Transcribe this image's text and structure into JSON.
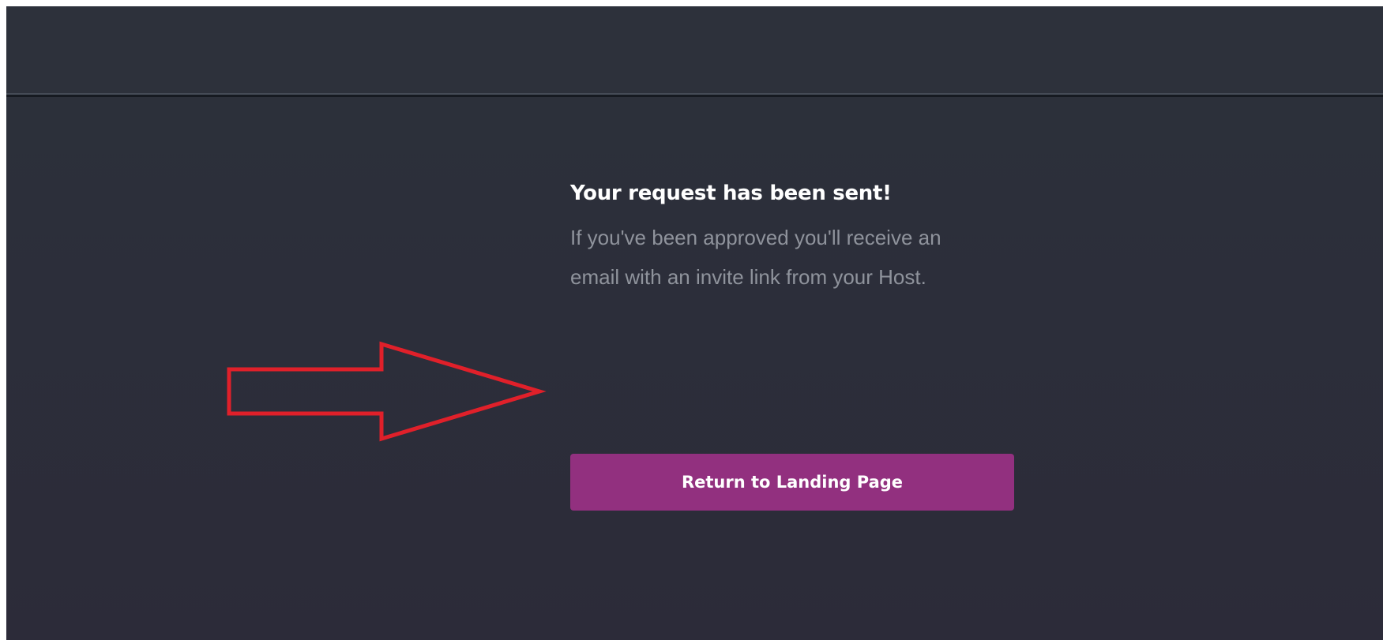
{
  "confirmation": {
    "heading": "Your request has been sent!",
    "message": "If you've been approved you'll receive an email with an invite link from your Host.",
    "button_label": "Return to Landing Page"
  },
  "colors": {
    "background": "#2c303a",
    "button": "#92307f",
    "annotation_arrow": "#e0202a"
  },
  "annotations": {
    "arrow_icon": "right-arrow-icon"
  }
}
